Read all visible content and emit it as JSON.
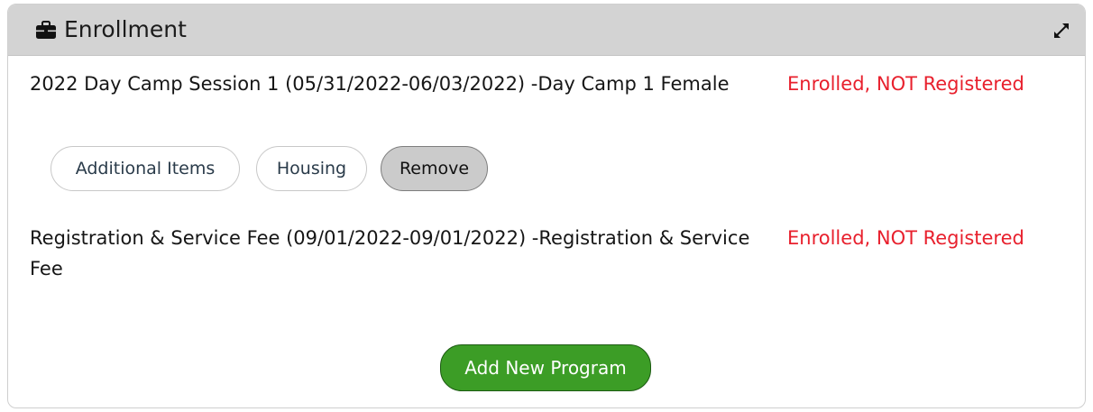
{
  "header": {
    "title": "Enrollment",
    "icon": "briefcase-icon",
    "expand_icon": "expand-icon"
  },
  "enrollments": [
    {
      "name": "2022 Day Camp Session 1 (05/31/2022-06/03/2022) -Day Camp 1 Female",
      "status": "Enrolled, NOT Registered",
      "actions": [
        "Additional Items",
        "Housing",
        "Remove"
      ]
    },
    {
      "name": "Registration & Service Fee (09/01/2022-09/01/2022) -Registration & Service Fee",
      "status": "Enrolled, NOT Registered"
    }
  ],
  "add_program_label": "Add New Program",
  "colors": {
    "status": "#e8202d",
    "add_button": "#3c9d26",
    "header_bg": "#d3d3d3"
  }
}
